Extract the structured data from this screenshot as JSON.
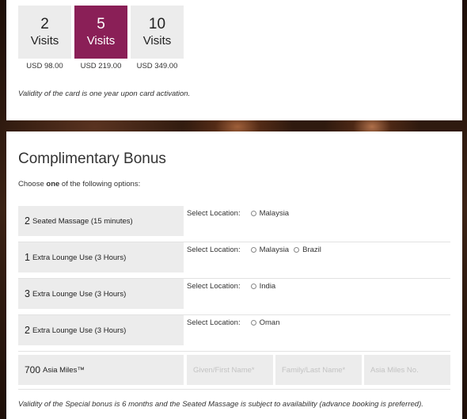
{
  "visits": [
    {
      "count": "2",
      "label": "Visits",
      "price": "USD 98.00"
    },
    {
      "count": "5",
      "label": "Visits",
      "price": "USD 219.00"
    },
    {
      "count": "10",
      "label": "Visits",
      "price": "USD 349.00"
    }
  ],
  "selected_visit_index": 1,
  "validity_card": "Validity of the card is one year upon card activation.",
  "bonus": {
    "title": "Complimentary Bonus",
    "choose_prefix": "Choose ",
    "choose_bold": "one",
    "choose_suffix": " of the following options:",
    "select_location_label": "Select Location:",
    "options": [
      {
        "count": "2",
        "label": "Seated Massage (15 minutes)",
        "locations": [
          "Malaysia"
        ]
      },
      {
        "count": "1",
        "label": "Extra Lounge Use (3 Hours)",
        "locations": [
          "Malaysia",
          "Brazil"
        ]
      },
      {
        "count": "3",
        "label": "Extra Lounge Use (3 Hours)",
        "locations": [
          "India"
        ]
      },
      {
        "count": "2",
        "label": "Extra Lounge Use (3 Hours)",
        "locations": [
          "Oman"
        ]
      }
    ],
    "miles": {
      "count": "700",
      "label": "Asia Miles™",
      "given_name_placeholder": "Given/First Name*",
      "family_name_placeholder": "Family/Last Name*",
      "miles_no_placeholder": "Asia Miles No."
    },
    "validity_bonus": "Validity of the Special bonus is 6 months and the Seated Massage is subject to availability (advance booking is preferred)."
  },
  "colors": {
    "accent": "#8a1f57",
    "tile_bg": "#ececec"
  }
}
